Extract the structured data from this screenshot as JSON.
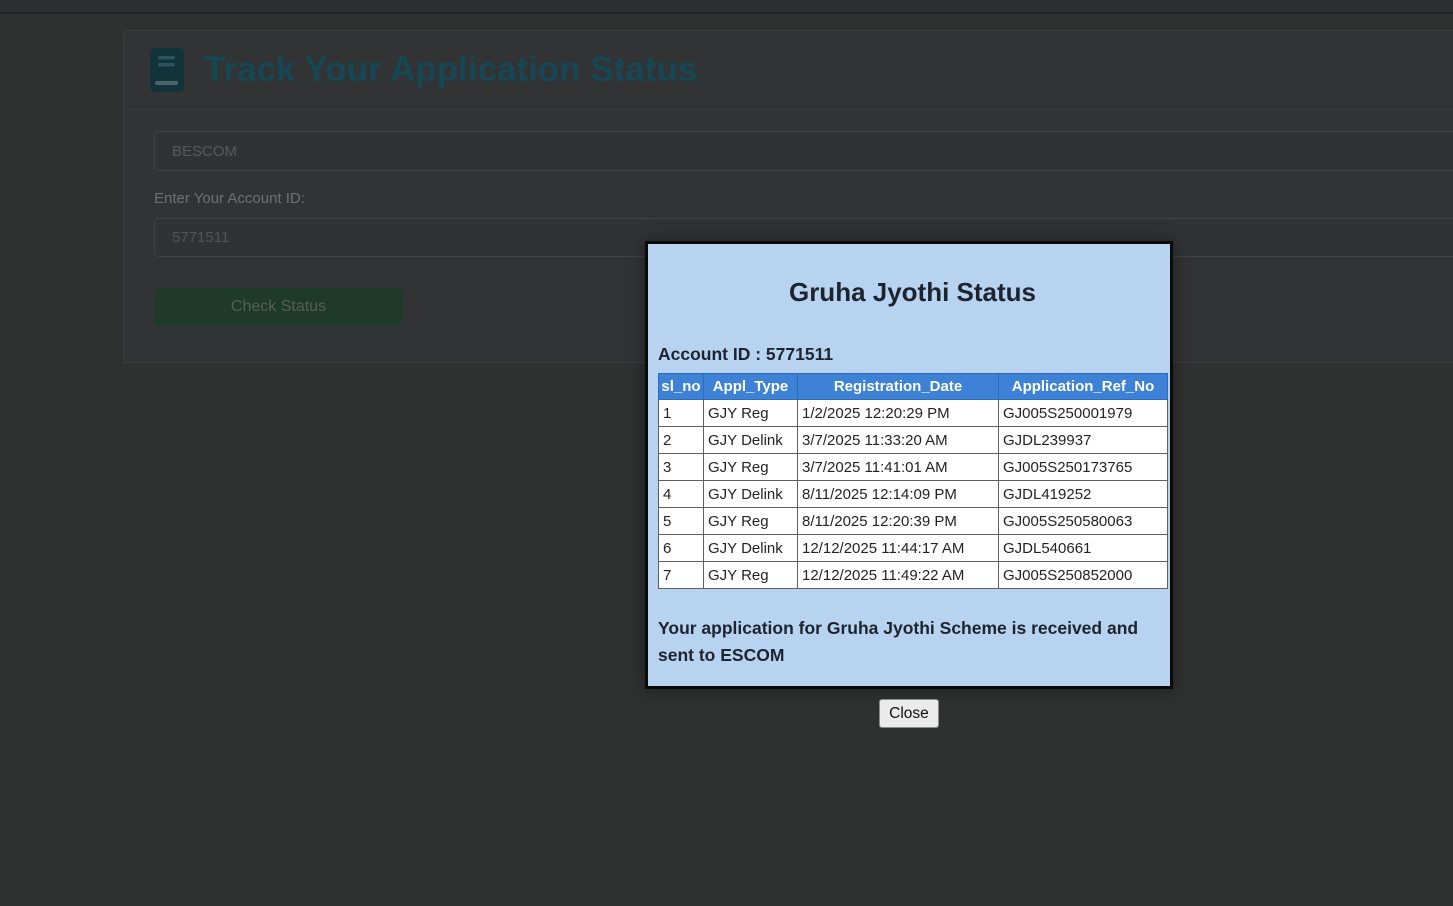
{
  "page": {
    "title": "Track Your Application Status"
  },
  "form": {
    "discom_value": "BESCOM",
    "account_label": "Enter Your Account ID:",
    "account_value": "5771511",
    "submit_label": "Check Status"
  },
  "modal": {
    "title": "Gruha Jyothi Status",
    "account_line": "Account ID : 5771511",
    "table": {
      "headers": [
        "sl_no",
        "Appl_Type",
        "Registration_Date",
        "Application_Ref_No"
      ],
      "rows": [
        [
          "1",
          "GJY Reg",
          "1/2/2025 12:20:29 PM",
          "GJ005S250001979"
        ],
        [
          "2",
          "GJY Delink",
          "3/7/2025 11:33:20 AM",
          "GJDL239937"
        ],
        [
          "3",
          "GJY Reg",
          "3/7/2025 11:41:01 AM",
          "GJ005S250173765"
        ],
        [
          "4",
          "GJY Delink",
          "8/11/2025 12:14:09 PM",
          "GJDL419252"
        ],
        [
          "5",
          "GJY Reg",
          "8/11/2025 12:20:39 PM",
          "GJ005S250580063"
        ],
        [
          "6",
          "GJY Delink",
          "12/12/2025 11:44:17 AM",
          "GJDL540661"
        ],
        [
          "7",
          "GJY Reg",
          "12/12/2025 11:49:22 AM",
          "GJ005S250852000"
        ]
      ]
    },
    "message": "Your application for Gruha Jyothi Scheme is received and sent to ESCOM",
    "close_label": "Close"
  },
  "icons": {
    "title_icon": "book-icon"
  },
  "colors": {
    "backdrop": "#2f3030",
    "title_teal": "#164754",
    "button_green": "#1f3a29",
    "modal_bg": "#b7d3f0",
    "modal_border": "#0a0a0a",
    "table_header_bg": "#3d82d7",
    "table_header_text": "#ffffff",
    "table_cell_bg": "#ffffff"
  }
}
